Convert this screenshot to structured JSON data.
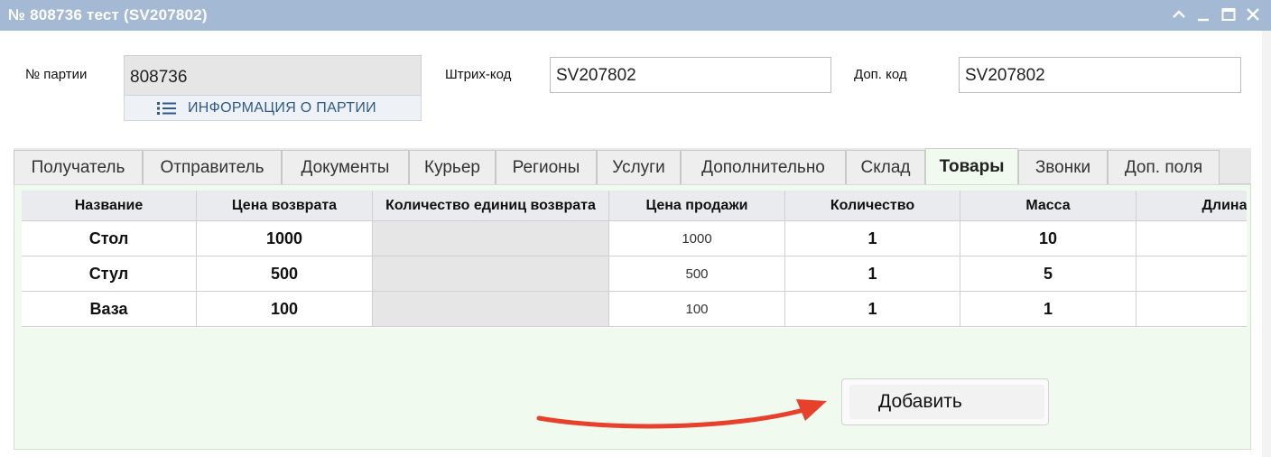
{
  "window": {
    "title": "№ 808736 тест (SV207802)",
    "controls": [
      "collapse-icon",
      "minimize-icon",
      "maximize-icon",
      "close-icon"
    ]
  },
  "form": {
    "party_label": "№ партии",
    "party_value": "808736",
    "info_button": "ИНФОРМАЦИЯ О ПАРТИИ",
    "barcode_label": "Штрих-код",
    "barcode_value": "SV207802",
    "extra_code_label": "Доп. код",
    "extra_code_value": "SV207802"
  },
  "tabs": [
    {
      "label": "Получатель"
    },
    {
      "label": "Отправитель"
    },
    {
      "label": "Документы"
    },
    {
      "label": "Курьер"
    },
    {
      "label": "Регионы"
    },
    {
      "label": "Услуги"
    },
    {
      "label": "Дополнительно"
    },
    {
      "label": "Склад"
    },
    {
      "label": "Товары",
      "active": true
    },
    {
      "label": "Звонки"
    },
    {
      "label": "Доп. поля"
    }
  ],
  "goods_table": {
    "columns": [
      "Название",
      "Цена возврата",
      "Количество единиц возврата",
      "Цена продажи",
      "Количество",
      "Масса",
      "Длина"
    ],
    "rows": [
      [
        "Стол",
        "1000",
        "",
        "1000",
        "1",
        "10",
        ""
      ],
      [
        "Стул",
        "500",
        "",
        "500",
        "1",
        "5",
        ""
      ],
      [
        "Ваза",
        "100",
        "",
        "100",
        "1",
        "1",
        ""
      ]
    ]
  },
  "add_button": "Добавить",
  "colors": {
    "titlebar": "#a4b9d3",
    "panel": "#f0faee",
    "arrow": "#e8412b",
    "link": "#2e5a88"
  }
}
